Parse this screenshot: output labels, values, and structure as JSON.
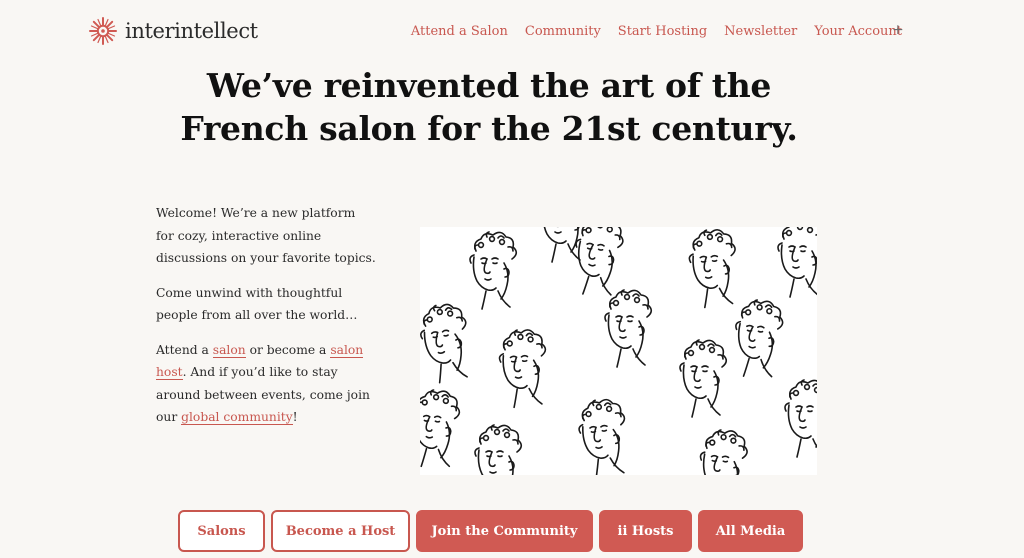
{
  "brand": {
    "name": "interintellect",
    "logo_icon": "star-burst-icon",
    "accent_color": "#c8574f"
  },
  "nav": {
    "items": [
      {
        "label": "Attend a Salon"
      },
      {
        "label": "Community"
      },
      {
        "label": "Start Hosting"
      },
      {
        "label": "Newsletter"
      },
      {
        "label": "Your Account"
      }
    ],
    "expand_label": "+"
  },
  "hero": {
    "headline_line1": "We’ve reinvented the art of the",
    "headline_line2": "French salon for the 21st century."
  },
  "intro": {
    "p1": "Welcome! We’re a new platform for cozy, interactive online discussions on your favorite topics.",
    "p2": "Come unwind with thoughtful people from all over the world…",
    "p3_before": "Attend a ",
    "p3_link1": "salon",
    "p3_mid1": " or become a ",
    "p3_link2": "salon host",
    "p3_mid2": ". And if you’d like to stay around between events, come join our ",
    "p3_link3": "global community",
    "p3_after": "!"
  },
  "illustration": {
    "icon": "line-drawn-classical-heads-pattern"
  },
  "buttons": [
    {
      "label": "Salons"
    },
    {
      "label": "Become a Host"
    },
    {
      "label": "Join the Community"
    },
    {
      "label": "ii Hosts"
    },
    {
      "label": "All Media"
    }
  ]
}
